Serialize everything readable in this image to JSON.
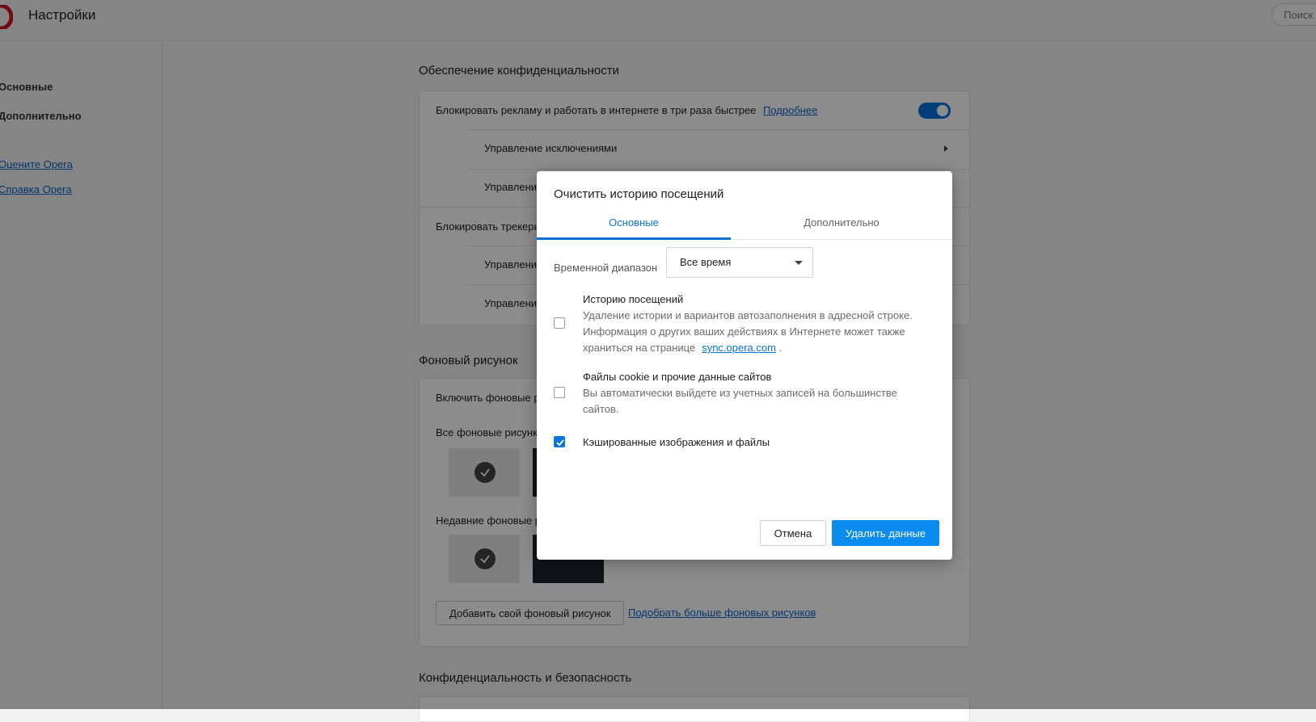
{
  "header": {
    "title": "Настройки",
    "search_placeholder": "Поиск"
  },
  "sidebar": {
    "items": [
      {
        "label": "Основные"
      },
      {
        "label": "Дополнительно"
      }
    ],
    "links": [
      {
        "label": "Оцените Opera"
      },
      {
        "label": "Справка Opera"
      }
    ]
  },
  "privacy": {
    "title": "Обеспечение конфиденциальности",
    "block_ads_label": "Блокировать рекламу и работать в интернете в три раза быстрее",
    "block_ads_link": "Подробнее",
    "block_ads_enabled": true,
    "manage_exceptions": "Управление исключениями",
    "manage_partial_1": "Управлени",
    "block_trackers": "Блокировать трекеры",
    "manage_partial_2": "Управлени",
    "manage_partial_3": "Управлени"
  },
  "wallpaper": {
    "title": "Фоновый рисунок",
    "enable_label": "Включить фоновые р",
    "all_label": "Все фоновые рисунк",
    "recent_label": "Недавние фоновые р",
    "add_button": "Добавить свой фоновый рисунок",
    "more_link": "Подобрать больше фоновых рисунков"
  },
  "security": {
    "title": "Конфиденциальность и безопасность"
  },
  "dialog": {
    "title": "Очистить историю посещений",
    "tabs": [
      {
        "label": "Основные",
        "active": true
      },
      {
        "label": "Дополнительно",
        "active": false
      }
    ],
    "time_range_label": "Временной диапазон",
    "time_range_value": "Все время",
    "options": [
      {
        "title": "Историю посещений",
        "description": "Удаление истории и вариантов автозаполнения в адресной строке. Информация о других ваших действиях в Интернете может также храниться на странице",
        "link": "sync.opera.com",
        "suffix": ".",
        "checked": false
      },
      {
        "title": "Файлы cookie и прочие данные сайтов",
        "description": "Вы автоматически выйдете из учетных записей на большинстве сайтов.",
        "checked": false
      },
      {
        "title": "Кэшированные изображения и файлы",
        "checked": true
      }
    ],
    "cancel_label": "Отмена",
    "confirm_label": "Удалить данные"
  },
  "colors": {
    "accent": "#0a73e0",
    "primary_button": "#0a8cf0",
    "brand": "#d01422"
  }
}
